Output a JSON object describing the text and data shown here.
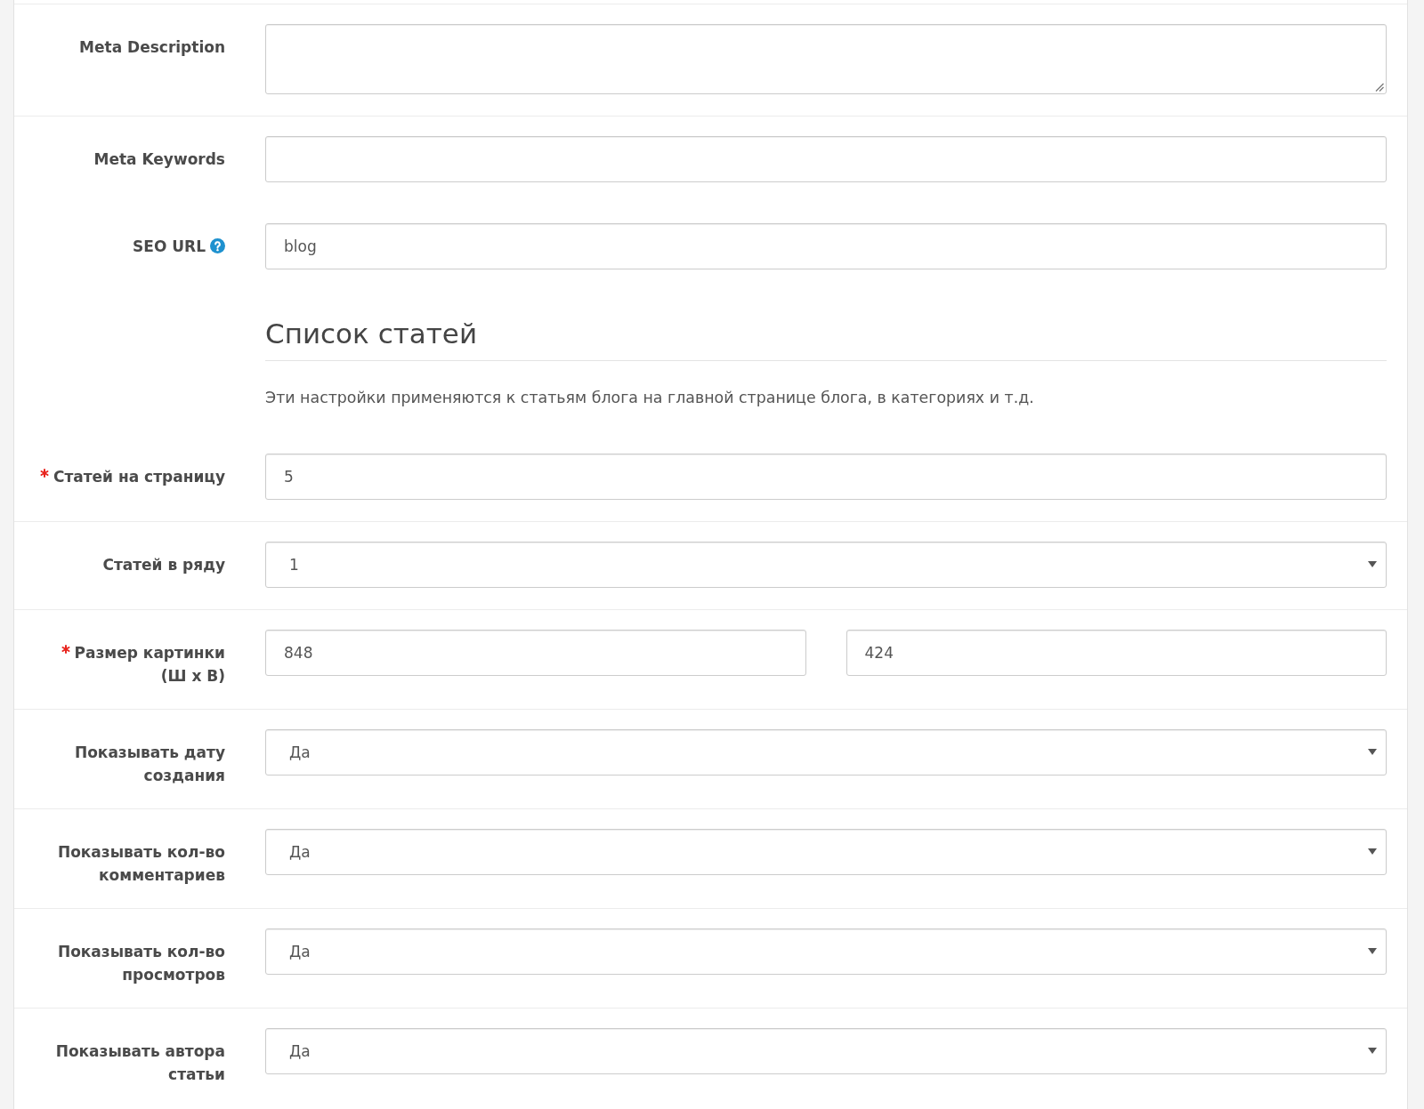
{
  "groups": [
    {
      "rows": [
        {
          "kind": "textarea",
          "label": "Meta Description",
          "required": false,
          "help": false
        }
      ]
    },
    {
      "rows": [
        {
          "kind": "input",
          "label": "Meta Keywords",
          "required": false,
          "help": false
        },
        {
          "kind": "input",
          "label": "SEO URL",
          "required": false,
          "help": true,
          "value": "blog"
        },
        {
          "kind": "heading",
          "title": "Список статей",
          "text": "Эти настройки применяются к статьям блога на главной странице блога, в категориях и т.д."
        },
        {
          "kind": "input",
          "label": "Статей на страницу",
          "required": true,
          "help": false,
          "value": "5"
        }
      ]
    },
    {
      "rows": [
        {
          "kind": "select",
          "label": "Статей в ряду",
          "required": false,
          "help": false,
          "value": "1"
        }
      ]
    },
    {
      "rows": [
        {
          "kind": "dual_input",
          "label": "Размер картинки (Ш x В)",
          "required": true,
          "help": false,
          "values": [
            "848",
            "424"
          ]
        }
      ]
    },
    {
      "rows": [
        {
          "kind": "select",
          "label": "Показывать дату создания",
          "required": false,
          "help": false,
          "value": "Да"
        }
      ]
    },
    {
      "rows": [
        {
          "kind": "select",
          "label": "Показывать кол-во комментариев",
          "required": false,
          "help": false,
          "value": "Да"
        }
      ]
    },
    {
      "rows": [
        {
          "kind": "select",
          "label": "Показывать кол-во просмотров",
          "required": false,
          "help": false,
          "value": "Да"
        }
      ]
    },
    {
      "rows": [
        {
          "kind": "select",
          "label": "Показывать автора статьи",
          "required": false,
          "help": false,
          "value": "Да"
        }
      ]
    }
  ]
}
